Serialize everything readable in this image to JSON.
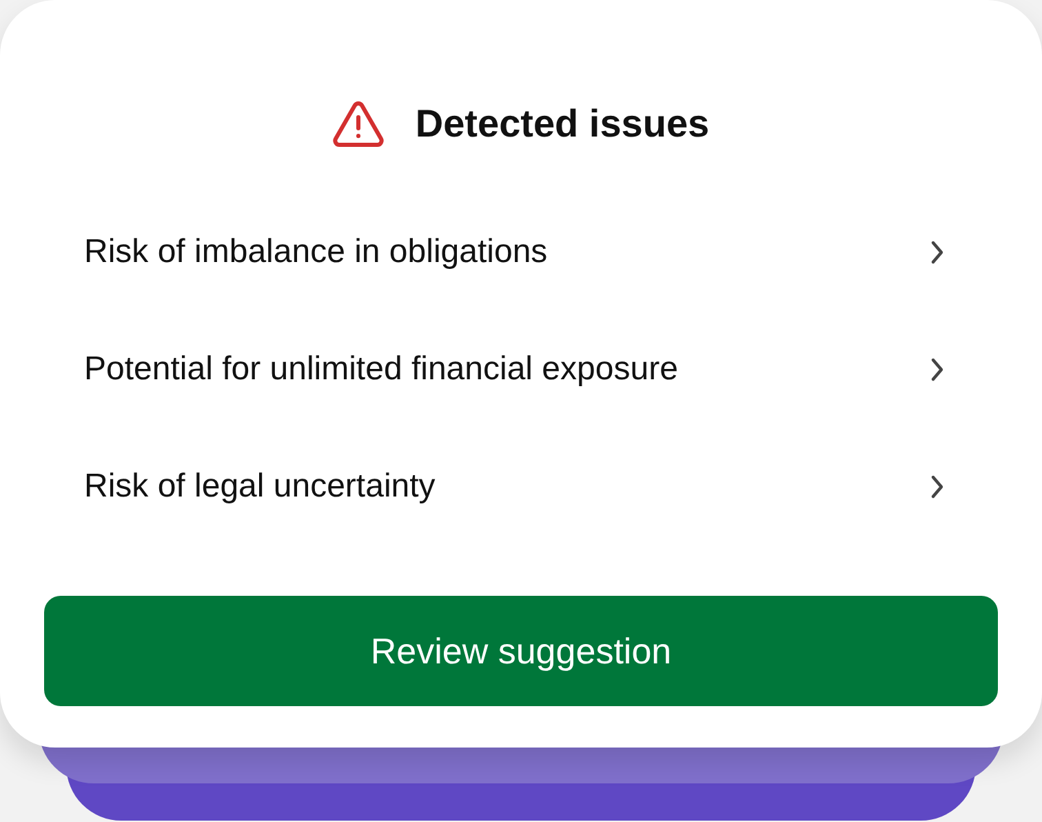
{
  "title": "Detected issues",
  "issues": [
    {
      "label": "Risk of imbalance in obligations"
    },
    {
      "label": "Potential for unlimited financial exposure"
    },
    {
      "label": "Risk of legal uncertainty"
    }
  ],
  "button": "Review suggestion"
}
